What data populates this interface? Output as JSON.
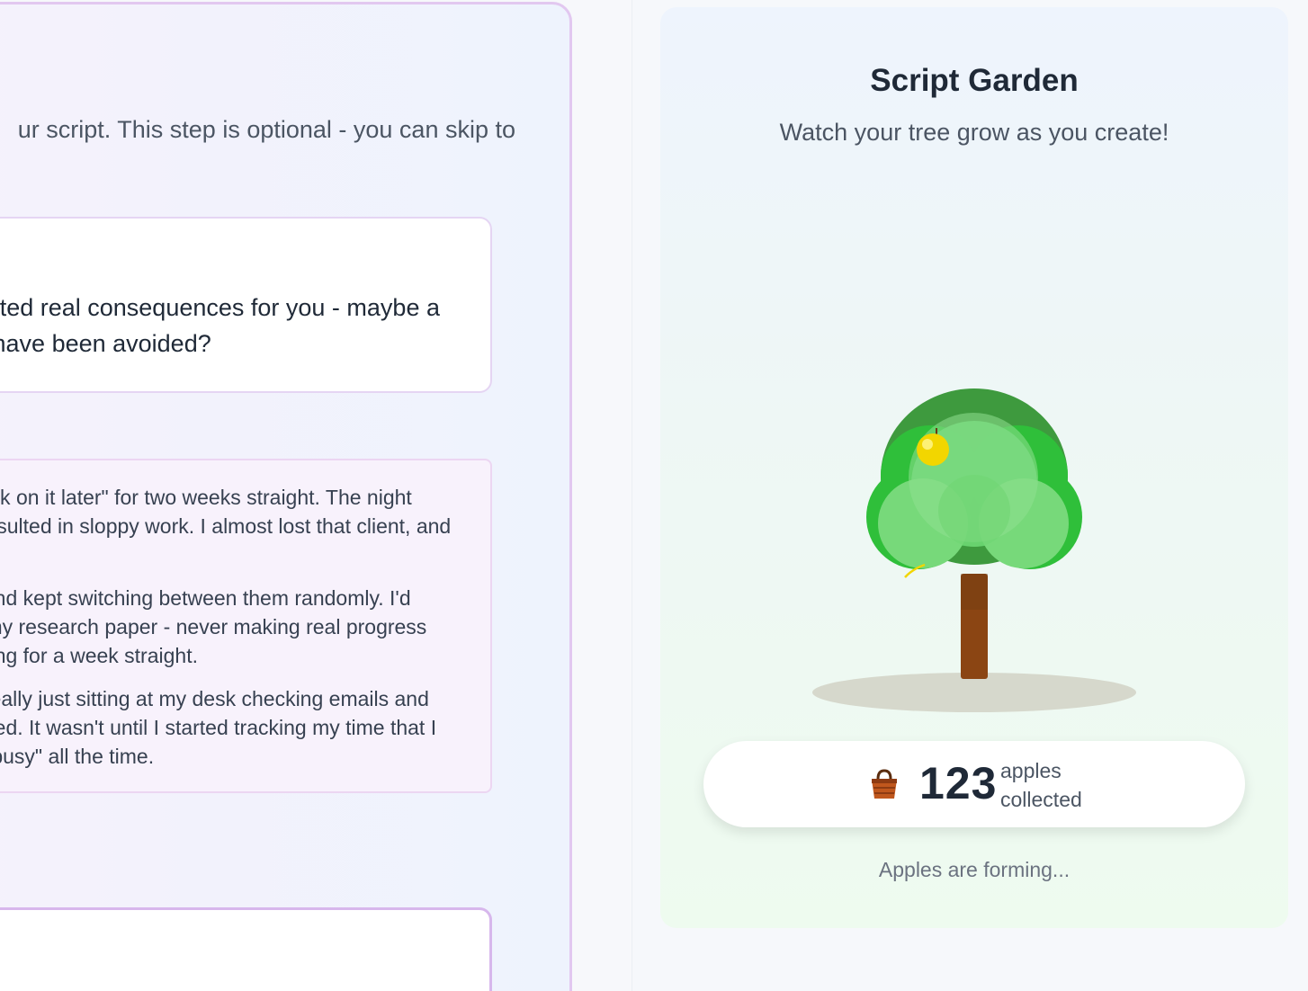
{
  "left_panel": {
    "instruction": "ur script. This step is optional - you can skip to",
    "prompt": {
      "line1": "eated real consequences for you - maybe a",
      "line2": "ld have been avoided?"
    },
    "examples": [
      "work on it later\" for two weeks straight. The night",
      "t resulted in sloppy work. I almost lost that client, and",
      "k and kept switching between them randomly. I'd",
      "rt my research paper - never making real progress",
      "eping for a week straight.",
      "s really just sitting at my desk checking emails and",
      "usted. It wasn't until I started tracking my time that I",
      "g \"busy\" all the time."
    ]
  },
  "garden": {
    "title": "Script Garden",
    "subtitle": "Watch your tree grow as you create!",
    "counter": {
      "value": "123",
      "label_line1": "apples",
      "label_line2": "collected",
      "icon": "basket-icon"
    },
    "status": "Apples are forming...",
    "colors": {
      "canopy_dark": "#3e9a3e",
      "canopy_mid": "#2fbf3a",
      "canopy_light": "#77d97a",
      "trunk": "#8b4513",
      "apple": "#f2d600",
      "shadow": "#d6d8cc"
    }
  }
}
